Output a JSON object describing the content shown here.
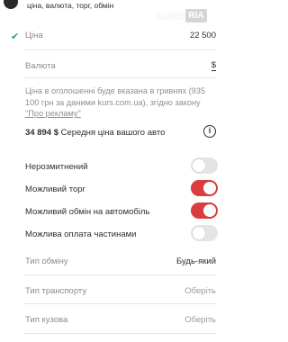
{
  "header": {
    "top_text": "ціна, валюта, торг, обмін",
    "logo_auto": "auto",
    "logo_ria": "RIA"
  },
  "price": {
    "label": "Ціна",
    "value": "22 500",
    "check_icon": "✔"
  },
  "currency": {
    "label": "Валюта",
    "value": "$"
  },
  "info": {
    "text": "Ціна в оголошенні буде вказана в гривнях (935 100 грн за даними kurs.com.ua), згідно закону ",
    "link": "\"Про рекламу\""
  },
  "average": {
    "amount": "34 894 $",
    "label": " Середня ціна вашого авто",
    "icon": "i"
  },
  "toggles": [
    {
      "label": "Нерозмитнений",
      "on": false
    },
    {
      "label": "Можливий торг",
      "on": true
    },
    {
      "label": "Можливий обмін на автомобіль",
      "on": true
    },
    {
      "label": "Можлива оплата частинами",
      "on": false
    }
  ],
  "selects": [
    {
      "label": "Тип обміну",
      "value": "Будь-який",
      "muted": false
    },
    {
      "label": "Тип транспорту",
      "value": "Оберіть",
      "muted": true
    },
    {
      "label": "Тип кузова",
      "value": "Оберіть",
      "muted": true
    }
  ],
  "colors": {
    "accent_red": "#db3c3e",
    "check_green": "#2aa65a",
    "toggle_off": "#e4e4e4"
  }
}
